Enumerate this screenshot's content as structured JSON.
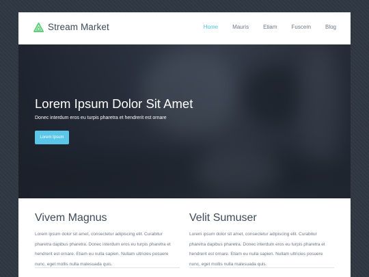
{
  "brand": {
    "name": "Stream Market",
    "accent": "#5ecf7a"
  },
  "nav": {
    "items": [
      {
        "label": "Home",
        "active": true
      },
      {
        "label": "Mauris",
        "active": false
      },
      {
        "label": "Etiam",
        "active": false
      },
      {
        "label": "Fuscem",
        "active": false
      },
      {
        "label": "Blog",
        "active": false
      }
    ],
    "active_color": "#4bbfe6"
  },
  "hero": {
    "title": "Lorem Ipsum Dolor Sit Amet",
    "subtitle": "Donec interdum eros eu turpis pharetra et hendrerit est ornare",
    "button_label": "Lorem Ipsum",
    "button_color": "#5bc6e8"
  },
  "columns": [
    {
      "title": "Vivem Magnus",
      "text": "Lorem ipsum dolor sit amet, consectetur adipiscing elit. Curabitur pharetra dapibus pharetra. Donec interdum eros eu turpis pharetra et hendrerit est ornare. Etiam eu nulla sapien. Nullam ultricies posuere nunc, eget mollis nulla malesuada quis."
    },
    {
      "title": "Velit Sumuser",
      "text": "Lorem ipsum dolor sit amet, consectetur adipiscing elit. Curabitur pharetra dapibus pharetra. Donec interdum eros eu turpis pharetra et hendrerit est ornare. Etiam eu nulla sapien. Nullam ultricies posuere nunc, eget mollis nulla malesuada quis."
    }
  ]
}
